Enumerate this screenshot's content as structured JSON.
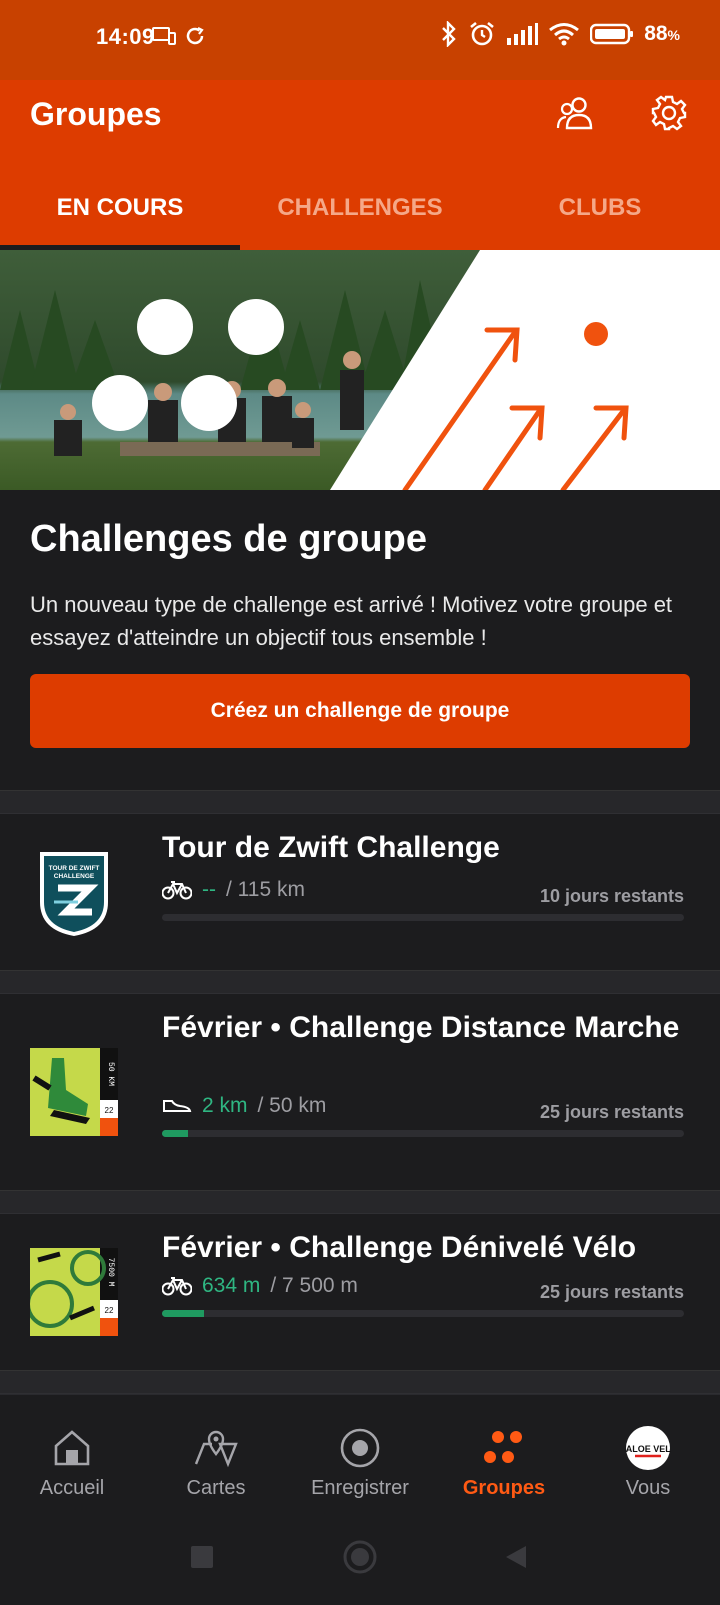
{
  "status_bar": {
    "time": "14:09",
    "battery": "88",
    "battery_unit": "%"
  },
  "app_bar": {
    "title": "Groupes"
  },
  "tabs": [
    {
      "label": "EN COURS",
      "active": true
    },
    {
      "label": "CHALLENGES",
      "active": false
    },
    {
      "label": "CLUBS",
      "active": false
    }
  ],
  "promo": {
    "heading": "Challenges de groupe",
    "description": "Un nouveau type de challenge est arrivé ! Motivez votre groupe et essayez d'atteindre un objectif tous ensemble !",
    "cta_label": "Créez un challenge de groupe"
  },
  "challenges": [
    {
      "name": "Tour de Zwift Challenge",
      "sport_icon": "bike-icon",
      "current": "--",
      "goal": "/ 115 km",
      "remaining": "10 jours restants",
      "progress_percent": 0,
      "badge_text_top": "TOUR DE ZWIFT",
      "badge_text_bottom": "CHALLENGE"
    },
    {
      "name": "Février • Challenge Distance Marche",
      "sport_icon": "shoe-icon",
      "current": "2 km",
      "goal": "/ 50 km",
      "remaining": "25 jours restants",
      "progress_percent": 5,
      "badge_side": "50 KM",
      "badge_year": "22"
    },
    {
      "name": "Février • Challenge Dénivelé Vélo",
      "sport_icon": "bike-icon",
      "current": "634 m",
      "goal": "/ 7 500 m",
      "remaining": "25 jours restants",
      "progress_percent": 8,
      "badge_side": "7500 M",
      "badge_year": "22"
    }
  ],
  "bottom_nav": [
    {
      "label": "Accueil",
      "icon": "home-icon",
      "active": false
    },
    {
      "label": "Cartes",
      "icon": "map-icon",
      "active": false
    },
    {
      "label": "Enregistrer",
      "icon": "record-icon",
      "active": false
    },
    {
      "label": "Groupes",
      "icon": "groups-icon",
      "active": true
    },
    {
      "label": "Vous",
      "icon": "avatar",
      "active": false,
      "avatar_text": "MALOE VELO"
    }
  ],
  "colors": {
    "brand": "#dd3c00",
    "status_bar": "#c84100",
    "progress": "#2fb682",
    "background": "#1c1c1e"
  }
}
